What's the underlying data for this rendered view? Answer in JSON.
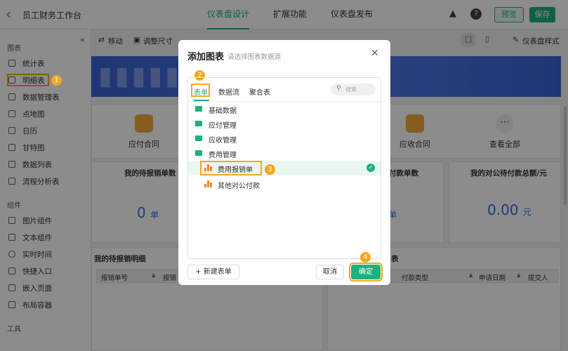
{
  "header": {
    "back_icon": "chevron-left-icon",
    "app_title": "员工财务工作台",
    "nav": [
      "仪表盘设计",
      "扩展功能",
      "仪表盘发布"
    ],
    "preview": "预览",
    "save": "保存",
    "accent": "#1bb27b"
  },
  "sidebar": {
    "section_charts": "图表",
    "chart_items": [
      "统计表",
      "明细表",
      "数据管理表",
      "点地图",
      "日历",
      "甘特图",
      "数据列表",
      "流程分析表"
    ],
    "section_components": "组件",
    "component_items": [
      "图片组件",
      "文本组件",
      "实时时间",
      "快捷入口",
      "嵌入页面",
      "布局容器"
    ],
    "section_tools": "工具"
  },
  "toolbar": {
    "move": "移动",
    "resize": "调整尺寸",
    "style": "仪表盘样式"
  },
  "canvas": {
    "quick_links": [
      "应付合同",
      "应收合同",
      "查看全部"
    ],
    "stats": [
      {
        "title": "我的待报销单数",
        "value": "0",
        "unit": "单"
      },
      {
        "title": "付款单数",
        "value": "",
        "unit": "单"
      },
      {
        "title": "我的对公待付款总额/元",
        "value": "0.00",
        "unit": "元"
      }
    ],
    "table_left_title": "我的待报销明细",
    "table_left_cols": [
      "报销单号",
      "报销"
    ],
    "table_right_title": "表",
    "table_right_cols": [
      "付款类型",
      "申请日期",
      "提交人"
    ]
  },
  "dialog": {
    "title": "添加图表",
    "subtitle": "请选择图表数据源",
    "tabs": [
      "表单",
      "数据流",
      "聚合表"
    ],
    "search_placeholder": "搜索",
    "folders": [
      "基础数据",
      "应付管理",
      "应收管理",
      "费用管理"
    ],
    "forms": [
      "费用报销单",
      "其他对公付款"
    ],
    "new_form": "新建表单",
    "cancel": "取消",
    "confirm": "确定"
  },
  "steps": [
    "1",
    "2",
    "3",
    "4"
  ]
}
